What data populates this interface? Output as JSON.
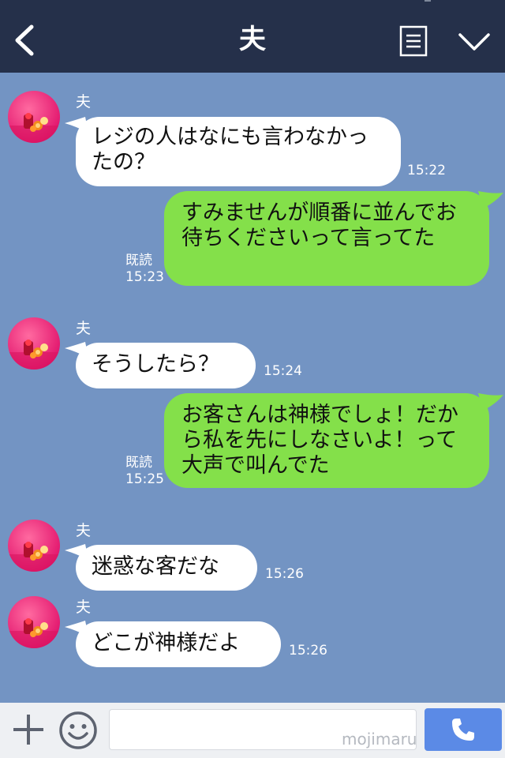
{
  "header": {
    "title": "夫"
  },
  "messages": [
    {
      "sender": "夫",
      "text": "レジの人はなにも言わなかったの？",
      "time": "15:22"
    },
    {
      "text": "すみませんが順番に並んでお待ちくださいって言ってた",
      "read": "既読",
      "time": "15:23"
    },
    {
      "sender": "夫",
      "text": "そうしたら？",
      "time": "15:24"
    },
    {
      "text": "お客さんは神様でしょ！だから私を先にしなさいよ！って大声で叫んでた",
      "read": "既読",
      "time": "15:25"
    },
    {
      "sender": "夫",
      "text": "迷惑な客だな",
      "time": "15:26"
    },
    {
      "sender": "夫",
      "text": "どこが神様だよ",
      "time": "15:26"
    }
  ],
  "input": {
    "watermark": "mojimaru"
  },
  "colors": {
    "header": "#25304a",
    "background": "#7394c3",
    "outgoing": "#84e04a",
    "incoming": "#ffffff",
    "call": "#5b8ae6"
  },
  "icons": {
    "back": "chevron-left-icon",
    "menu": "document-menu-icon",
    "collapse": "chevron-down-icon",
    "add": "plus-icon",
    "sticker": "smile-icon",
    "call": "phone-icon"
  }
}
